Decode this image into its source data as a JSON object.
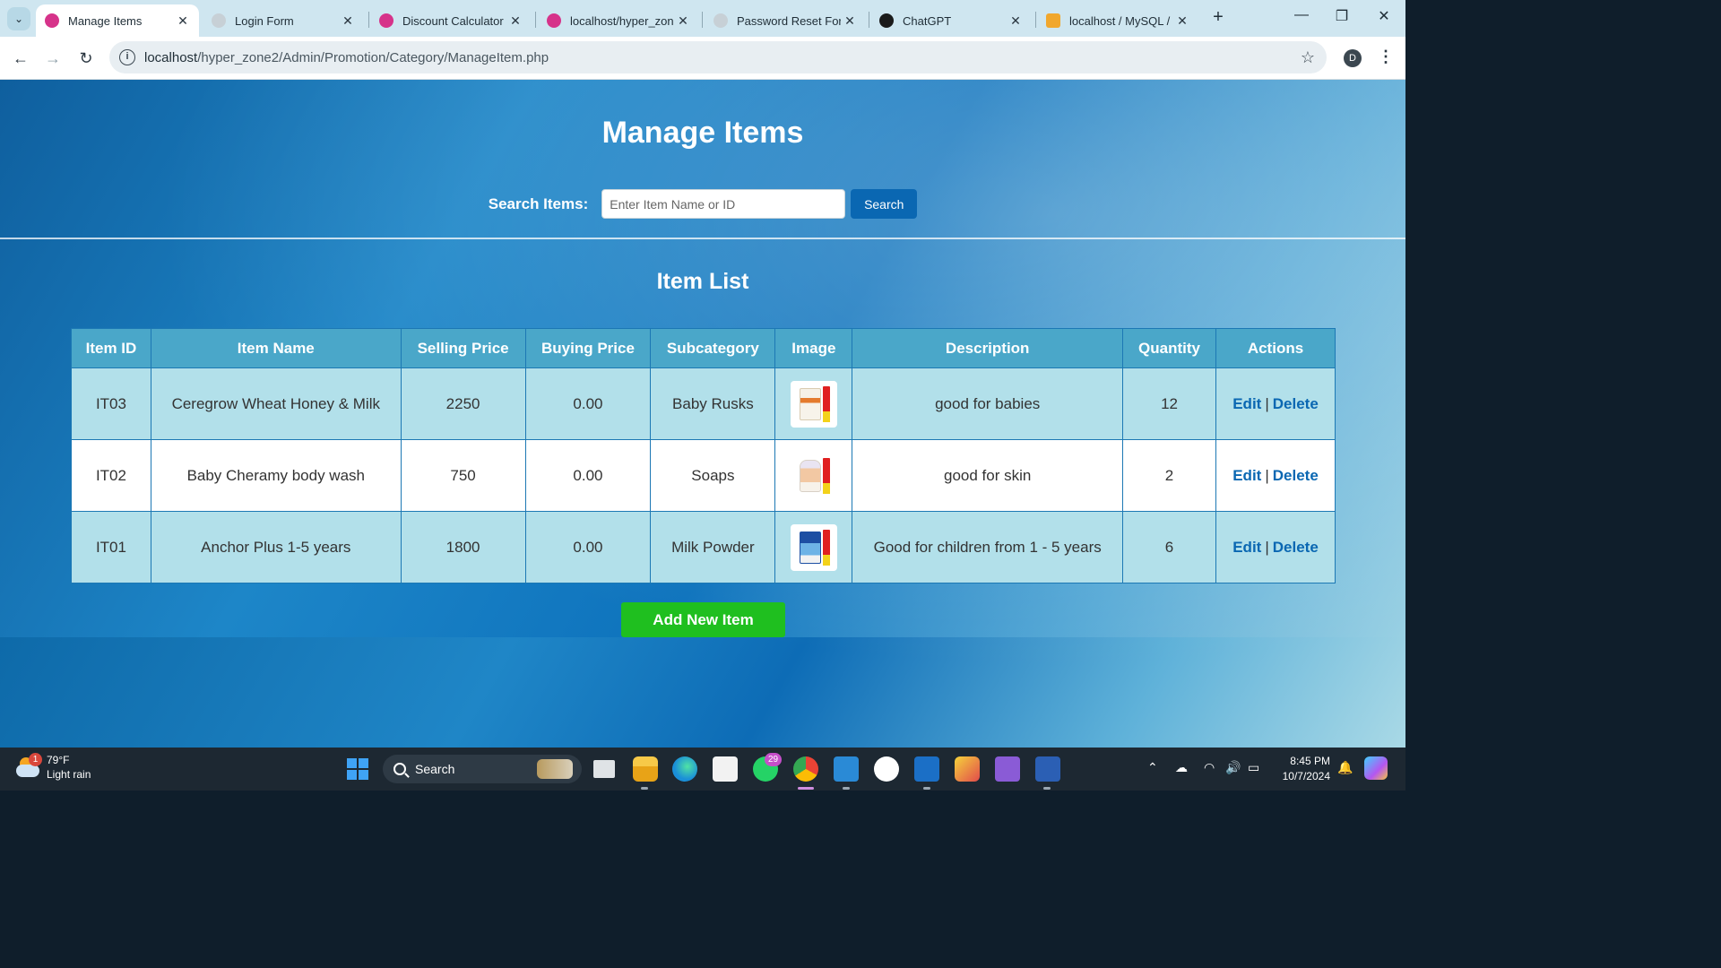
{
  "browser": {
    "tabs": [
      {
        "label": "Manage Items",
        "active": true,
        "favicon": "wamp-icon"
      },
      {
        "label": "Login Form",
        "active": false,
        "favicon": "globe-icon"
      },
      {
        "label": "Discount Calculator",
        "active": false,
        "favicon": "wamp-icon"
      },
      {
        "label": "localhost/hyper_zone",
        "active": false,
        "favicon": "wamp-icon"
      },
      {
        "label": "Password Reset Form",
        "active": false,
        "favicon": "globe-icon"
      },
      {
        "label": "ChatGPT",
        "active": false,
        "favicon": "chatgpt-icon"
      },
      {
        "label": "localhost / MySQL / c",
        "active": false,
        "favicon": "phpmyadmin-icon"
      }
    ],
    "url_host": "localhost",
    "url_path": "/hyper_zone2/Admin/Promotion/Category/ManageItem.php",
    "profile_initial": "D"
  },
  "page": {
    "title": "Manage Items",
    "search": {
      "label": "Search Items:",
      "placeholder": "Enter Item Name or ID",
      "value": "",
      "button": "Search"
    },
    "list_title": "Item List",
    "table": {
      "headers": [
        "Item ID",
        "Item Name",
        "Selling Price",
        "Buying Price",
        "Subcategory",
        "Image",
        "Description",
        "Quantity",
        "Actions"
      ],
      "rows": [
        {
          "id": "IT03",
          "name": "Ceregrow Wheat Honey & Milk",
          "selling": "2250",
          "buying": "0.00",
          "subcategory": "Baby Rusks",
          "image": "ceregrow-product-image",
          "description": "good for babies",
          "quantity": "12"
        },
        {
          "id": "IT02",
          "name": "Baby Cheramy body wash",
          "selling": "750",
          "buying": "0.00",
          "subcategory": "Soaps",
          "image": "baby-cheramy-product-image",
          "description": "good for skin",
          "quantity": "2"
        },
        {
          "id": "IT01",
          "name": "Anchor Plus 1-5 years",
          "selling": "1800",
          "buying": "0.00",
          "subcategory": "Milk Powder",
          "image": "anchor-plus-product-image",
          "description": "Good for children from 1 - 5 years",
          "quantity": "6"
        }
      ],
      "edit_label": "Edit",
      "separator": "|",
      "delete_label": "Delete"
    },
    "add_button": "Add New Item"
  },
  "taskbar": {
    "weather_temp": "79°F",
    "weather_desc": "Light rain",
    "weather_badge": "1",
    "search_label": "Search",
    "whatsapp_badge": "29",
    "time": "8:45 PM",
    "date": "10/7/2024"
  },
  "colors": {
    "accent": "#0a67b2",
    "add_button": "#1fbf1f",
    "table_header": "#4aa7c9",
    "row_alt": "#b2e0ea"
  }
}
